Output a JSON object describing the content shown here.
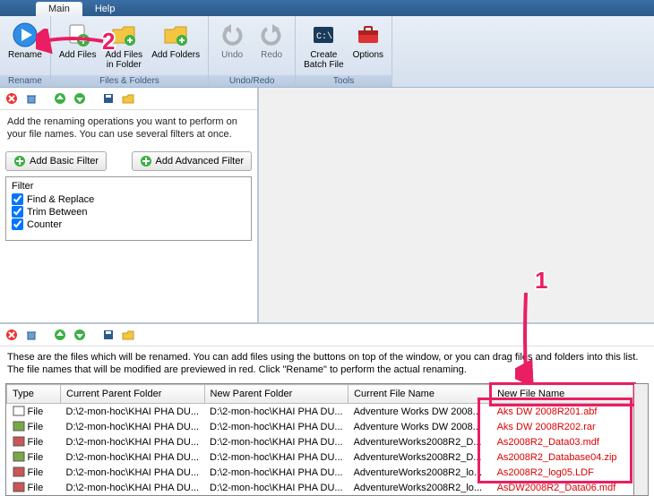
{
  "tabs": {
    "main": "Main",
    "help": "Help"
  },
  "ribbon": {
    "rename": "Rename",
    "addfiles": "Add Files",
    "addfolder": "Add Files\nin Folder",
    "addfolders": "Add Folders",
    "undo": "Undo",
    "redo": "Redo",
    "createbatch": "Create\nBatch File",
    "options": "Options",
    "group_rename": "Rename",
    "group_files": "Files & Folders",
    "group_undo": "Undo/Redo",
    "group_tools": "Tools"
  },
  "leftpanel": {
    "hint": "Add the renaming operations you want to perform on your file names. You can use several filters at once.",
    "addbasic": "Add Basic Filter",
    "addadv": "Add Advanced Filter",
    "filterhdr": "Filter",
    "filters": [
      "Find & Replace",
      "Trim Between",
      "Counter"
    ]
  },
  "bottom": {
    "hint": "These are the files which will be renamed. You can add files using the buttons on top of the window, or you can drag files and folders into this list. The file names that will be modified are previewed in red. Click \"Rename\" to perform the actual renaming.",
    "cols": [
      "Type",
      "Current Parent Folder",
      "New Parent Folder",
      "Current File Name",
      "New File Name"
    ],
    "rows": [
      {
        "type": "File",
        "cpf": "D:\\2-mon-hoc\\KHAI PHA DU...",
        "npf": "D:\\2-mon-hoc\\KHAI PHA DU...",
        "cfn": "Adventure Works DW 2008...",
        "nfn": "Aks DW 2008R201.abf"
      },
      {
        "type": "File",
        "cpf": "D:\\2-mon-hoc\\KHAI PHA DU...",
        "npf": "D:\\2-mon-hoc\\KHAI PHA DU...",
        "cfn": "Adventure Works DW 2008...",
        "nfn": "Aks DW 2008R202.rar"
      },
      {
        "type": "File",
        "cpf": "D:\\2-mon-hoc\\KHAI PHA DU...",
        "npf": "D:\\2-mon-hoc\\KHAI PHA DU...",
        "cfn": "AdventureWorks2008R2_D...",
        "nfn": "As2008R2_Data03.mdf"
      },
      {
        "type": "File",
        "cpf": "D:\\2-mon-hoc\\KHAI PHA DU...",
        "npf": "D:\\2-mon-hoc\\KHAI PHA DU...",
        "cfn": "AdventureWorks2008R2_D...",
        "nfn": "As2008R2_Database04.zip"
      },
      {
        "type": "File",
        "cpf": "D:\\2-mon-hoc\\KHAI PHA DU...",
        "npf": "D:\\2-mon-hoc\\KHAI PHA DU...",
        "cfn": "AdventureWorks2008R2_lo...",
        "nfn": "As2008R2_log05.LDF"
      },
      {
        "type": "File",
        "cpf": "D:\\2-mon-hoc\\KHAI PHA DU...",
        "npf": "D:\\2-mon-hoc\\KHAI PHA DU...",
        "cfn": "AdventureWorks2008R2_lo...",
        "nfn": "AsDW2008R2_Data06.mdf"
      }
    ]
  },
  "anno": {
    "n1": "1",
    "n2": "2"
  }
}
